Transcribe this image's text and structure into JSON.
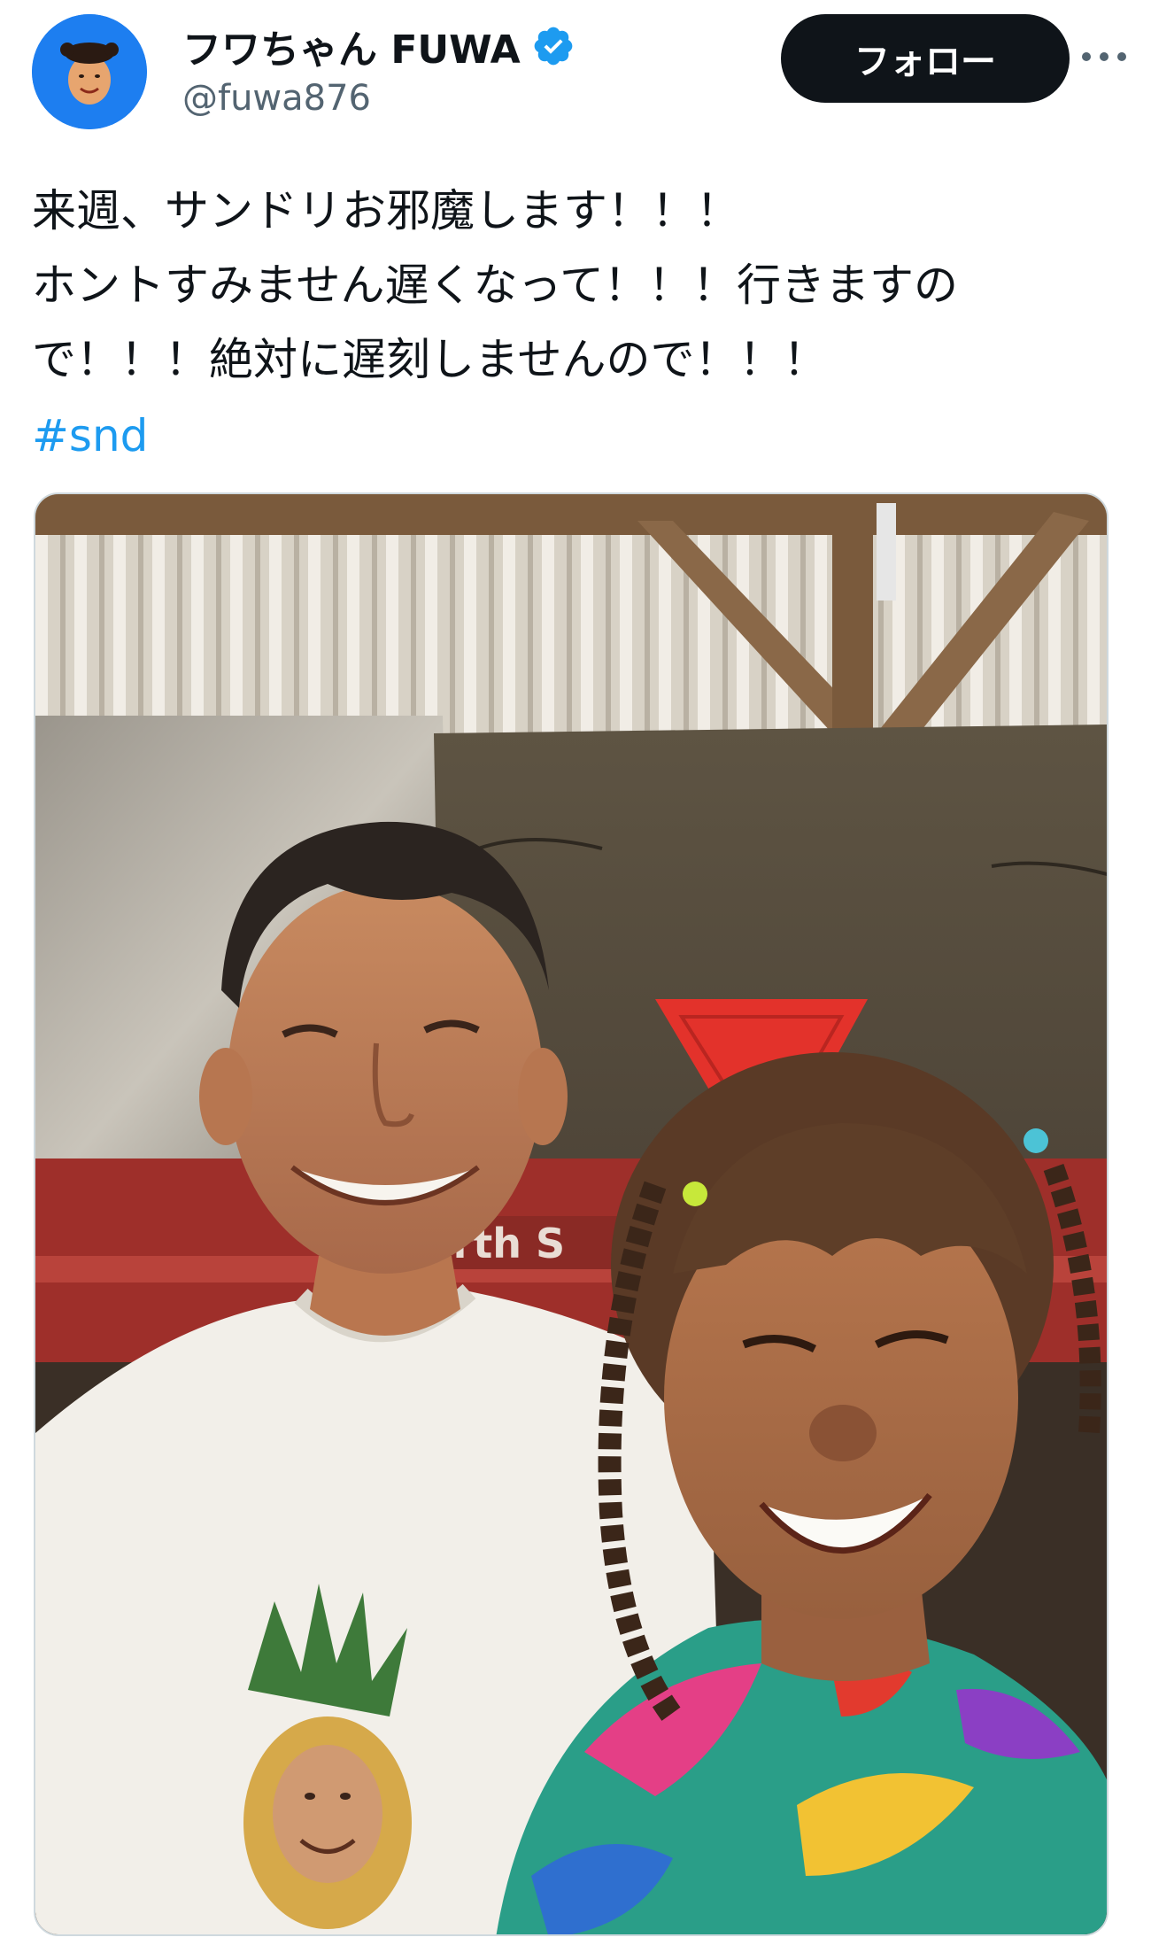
{
  "author": {
    "display_name": "フワちゃん FUWA",
    "handle": "@fuwa876",
    "verified": true,
    "avatar_icon": "profile-avatar-icon",
    "avatar_bg": "#1d7ef0"
  },
  "actions": {
    "follow_label": "フォロー",
    "more_icon": "more-options-icon"
  },
  "tweet": {
    "lines": [
      "来週、サンドリお邪魔します！！！",
      "ホントすみません遅くなって！！！行きますの",
      "で！！！絶対に遅刻しませんので！！！"
    ],
    "hashtag": "#snd"
  },
  "media": {
    "type": "photo",
    "sign_text": "orth S"
  },
  "colors": {
    "text": "#0f1419",
    "secondary": "#536471",
    "link": "#1d9bf0",
    "verified": "#1d9bf0",
    "follow_bg": "#0f1419"
  }
}
